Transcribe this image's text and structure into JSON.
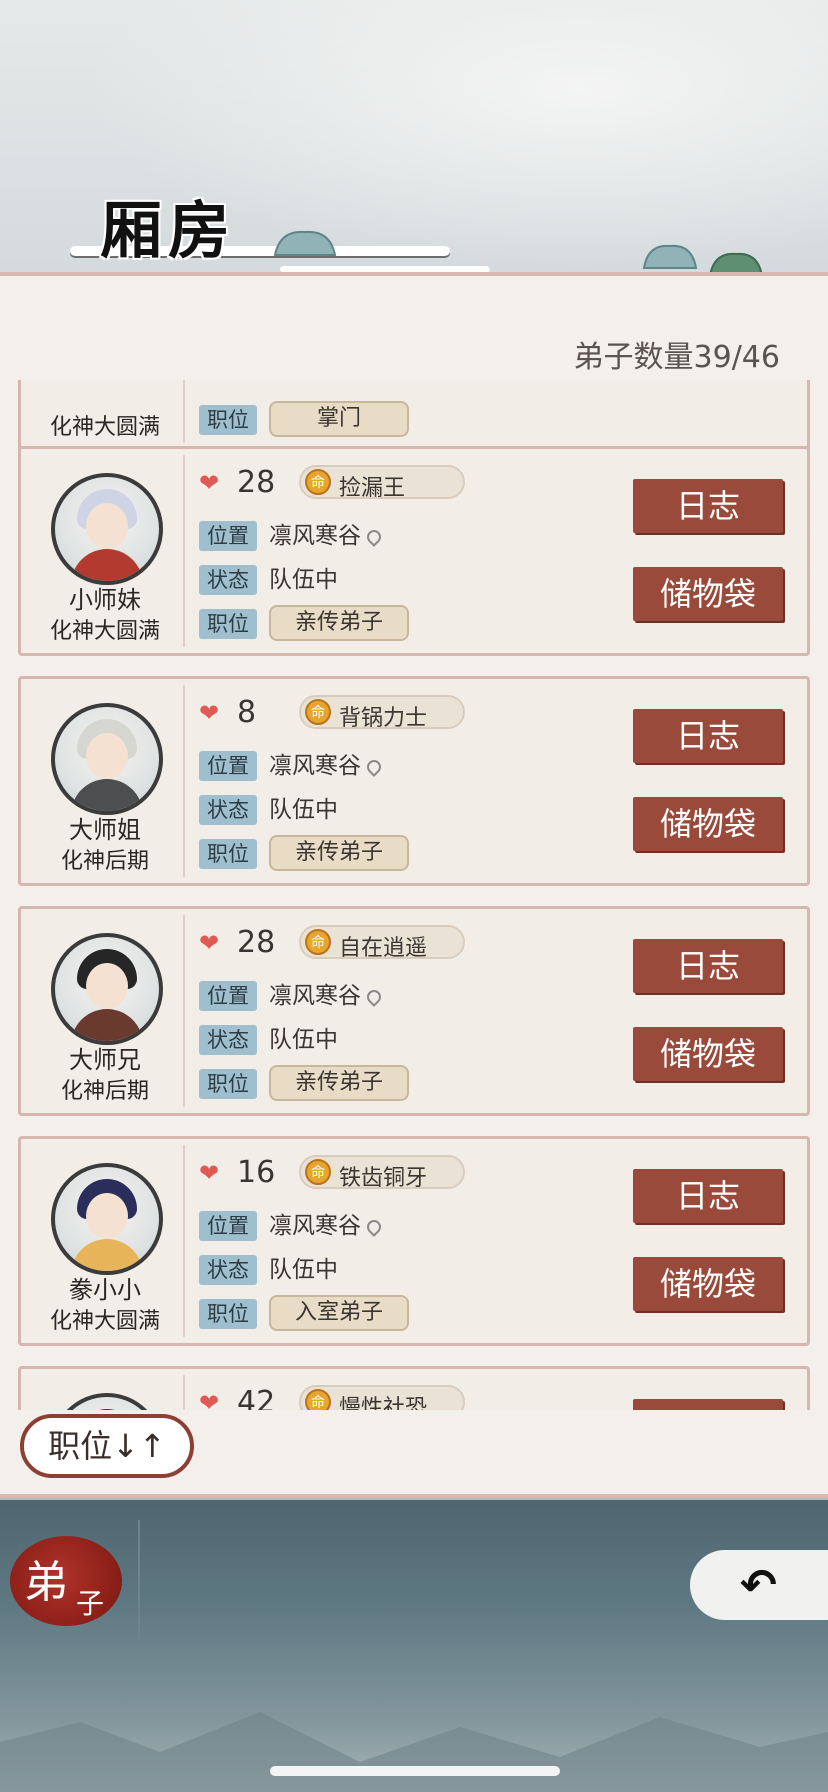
{
  "header": {
    "title": "厢房",
    "disciple_count": "弟子数量39/46"
  },
  "partial_top": {
    "realm": "化神大圆满",
    "position_tag": "职位",
    "position": "掌门"
  },
  "labels": {
    "location": "位置",
    "status": "状态",
    "position": "职位",
    "log_button": "日志",
    "bag_button": "储物袋"
  },
  "disciples": [
    {
      "name": "小师妹",
      "realm": "化神大圆满",
      "hp": "28",
      "trait": "捡漏王",
      "location": "凛风寒谷",
      "status": "队伍中",
      "position": "亲传弟子",
      "hair_color": "#cfd3e6",
      "robe_color": "#b33a2f"
    },
    {
      "name": "大师姐",
      "realm": "化神后期",
      "hp": "8",
      "trait": "背锅力士",
      "location": "凛风寒谷",
      "status": "队伍中",
      "position": "亲传弟子",
      "hair_color": "#d6d6d0",
      "robe_color": "#4c4e4f"
    },
    {
      "name": "大师兄",
      "realm": "化神后期",
      "hp": "28",
      "trait": "自在逍遥",
      "location": "凛风寒谷",
      "status": "队伍中",
      "position": "亲传弟子",
      "hair_color": "#262626",
      "robe_color": "#6b3a2e"
    },
    {
      "name": "豢小小",
      "realm": "化神大圆满",
      "hp": "16",
      "trait": "铁齿铜牙",
      "location": "凛风寒谷",
      "status": "队伍中",
      "position": "入室弟子",
      "hair_color": "#2b2e5a",
      "robe_color": "#e8b45a"
    }
  ],
  "partial_bottom": {
    "hp": "42",
    "trait": "慢性社恐"
  },
  "trait_icon_char": "命",
  "sort_button": "职位↓↑",
  "footer": {
    "tab_big": "弟",
    "tab_small": "子",
    "back_icon": "back-arrow-icon"
  }
}
